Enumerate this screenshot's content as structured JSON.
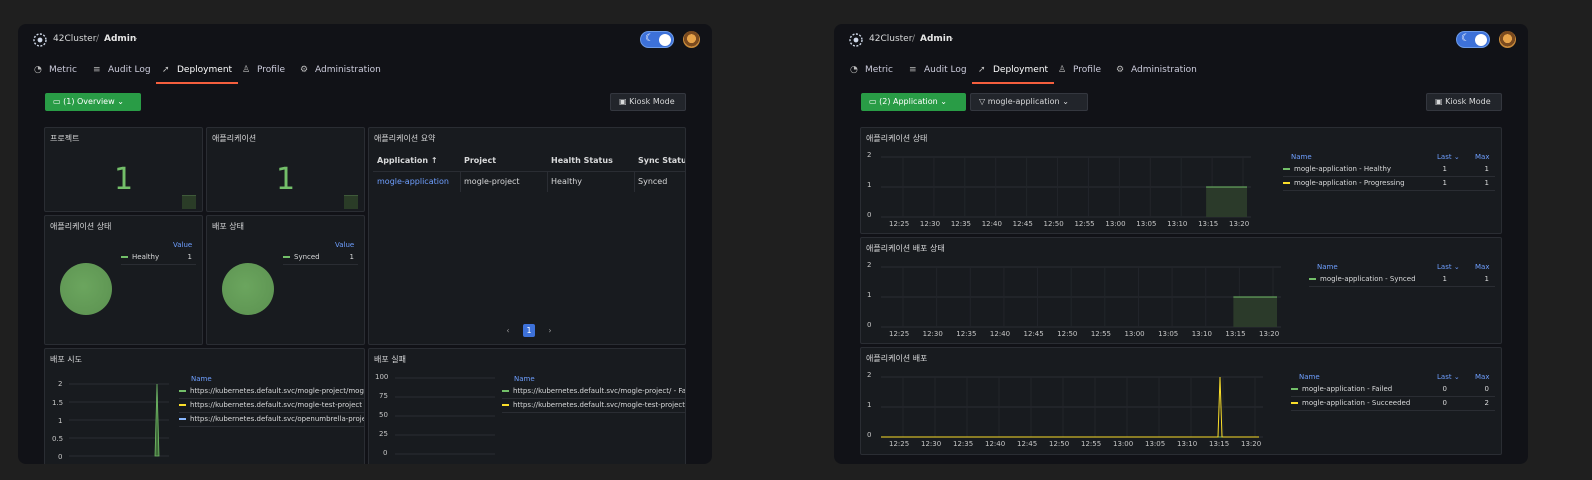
{
  "header": {
    "cluster": "42Cluster",
    "separator": "/",
    "org": "Admin",
    "tabs": [
      {
        "label": "Metric",
        "icon": "speedometer-icon"
      },
      {
        "label": "Audit Log",
        "icon": "list-icon"
      },
      {
        "label": "Deployment",
        "icon": "rocket-icon"
      },
      {
        "label": "Profile",
        "icon": "user-icon"
      },
      {
        "label": "Administration",
        "icon": "gear-icon"
      }
    ],
    "active_tab": "Deployment"
  },
  "colors": {
    "accent": "#f55f3e",
    "green": "#299c46",
    "healthy": "#73bf69",
    "progressing": "#fade2a",
    "blue": "#3d71d9"
  },
  "left": {
    "view_select": "(1) Overview",
    "kiosk": "Kiosk Mode",
    "projects": {
      "title": "프로젝트",
      "value": "1"
    },
    "applications": {
      "title": "애플리케이션",
      "value": "1"
    },
    "summary": {
      "title": "애플리케이션 요약",
      "columns": [
        "Application",
        "Project",
        "Health Status",
        "Sync Statu"
      ],
      "sort_arrow": "↑",
      "rows": [
        [
          "mogle-application",
          "mogle-project",
          "Healthy",
          "Synced"
        ]
      ],
      "pagination": {
        "prev": "‹",
        "page": "1",
        "next": "›"
      }
    },
    "app_status": {
      "title": "애플리케이션 상태",
      "legend_header": "Value",
      "legend": [
        {
          "name": "Healthy",
          "value": "1"
        }
      ]
    },
    "deploy_status": {
      "title": "배포 상태",
      "legend_header": "Value",
      "legend": [
        {
          "name": "Synced",
          "value": "1"
        }
      ]
    },
    "deploy_attempts": {
      "title": "배포 시도",
      "legend_header": "Name",
      "yticks": [
        "2",
        "1.5",
        "1",
        "0.5",
        "0"
      ],
      "legend": [
        {
          "name": "https://kubernetes.default.svc/mogle-project/mog",
          "color": "#73bf69"
        },
        {
          "name": "https://kubernetes.default.svc/mogle-test-project",
          "color": "#fade2a"
        },
        {
          "name": "https://kubernetes.default.svc/openumbrella-proje",
          "color": "#8ab8ff"
        }
      ]
    },
    "deploy_failures": {
      "title": "배포 실패",
      "legend_header": "Name",
      "yticks": [
        "100",
        "75",
        "50",
        "25",
        "0"
      ],
      "legend": [
        {
          "name": "https://kubernetes.default.svc/mogle-project/ - Fa",
          "color": "#73bf69"
        },
        {
          "name": "https://kubernetes.default.svc/mogle-test-project",
          "color": "#fade2a"
        }
      ]
    }
  },
  "right": {
    "view_select": "(2) Application",
    "app_filter": "mogle-application",
    "kiosk": "Kiosk Mode",
    "xticks": [
      "12:25",
      "12:30",
      "12:35",
      "12:40",
      "12:45",
      "12:50",
      "12:55",
      "13:00",
      "13:05",
      "13:10",
      "13:15",
      "13:20"
    ],
    "legend_cols": {
      "name": "Name",
      "last": "Last",
      "max": "Max"
    },
    "panels": [
      {
        "title": "애플리케이션 상태",
        "yticks": [
          "2",
          "1",
          "0"
        ],
        "legend": [
          {
            "name": "mogle-application - Healthy",
            "last": "1",
            "max": "1",
            "color": "#73bf69"
          },
          {
            "name": "mogle-application - Progressing",
            "last": "1",
            "max": "1",
            "color": "#fade2a"
          }
        ]
      },
      {
        "title": "애플리케이션 배포 상태",
        "yticks": [
          "2",
          "1",
          "0"
        ],
        "legend": [
          {
            "name": "mogle-application - Synced",
            "last": "1",
            "max": "1",
            "color": "#73bf69"
          }
        ]
      },
      {
        "title": "애플리케이션 배포",
        "yticks": [
          "2",
          "1",
          "0"
        ],
        "legend": [
          {
            "name": "mogle-application - Failed",
            "last": "0",
            "max": "0",
            "color": "#73bf69"
          },
          {
            "name": "mogle-application - Succeeded",
            "last": "0",
            "max": "2",
            "color": "#fade2a"
          }
        ]
      }
    ]
  },
  "chart_data": [
    {
      "type": "line",
      "title": "애플리케이션 상태",
      "x": [
        "13:15",
        "13:20"
      ],
      "series": [
        {
          "name": "mogle-application - Healthy",
          "values": [
            1,
            1
          ]
        },
        {
          "name": "mogle-application - Progressing",
          "values": [
            1,
            1
          ]
        }
      ],
      "ylim": [
        0,
        2
      ]
    },
    {
      "type": "line",
      "title": "애플리케이션 배포 상태",
      "x": [
        "13:15",
        "13:20"
      ],
      "series": [
        {
          "name": "mogle-application - Synced",
          "values": [
            1,
            1
          ]
        }
      ],
      "ylim": [
        0,
        2
      ]
    },
    {
      "type": "line",
      "title": "애플리케이션 배포",
      "x": [
        "13:14",
        "13:15"
      ],
      "series": [
        {
          "name": "mogle-application - Failed",
          "values": [
            0,
            0
          ]
        },
        {
          "name": "mogle-application - Succeeded",
          "values": [
            0,
            2
          ]
        }
      ],
      "ylim": [
        0,
        2
      ]
    }
  ]
}
